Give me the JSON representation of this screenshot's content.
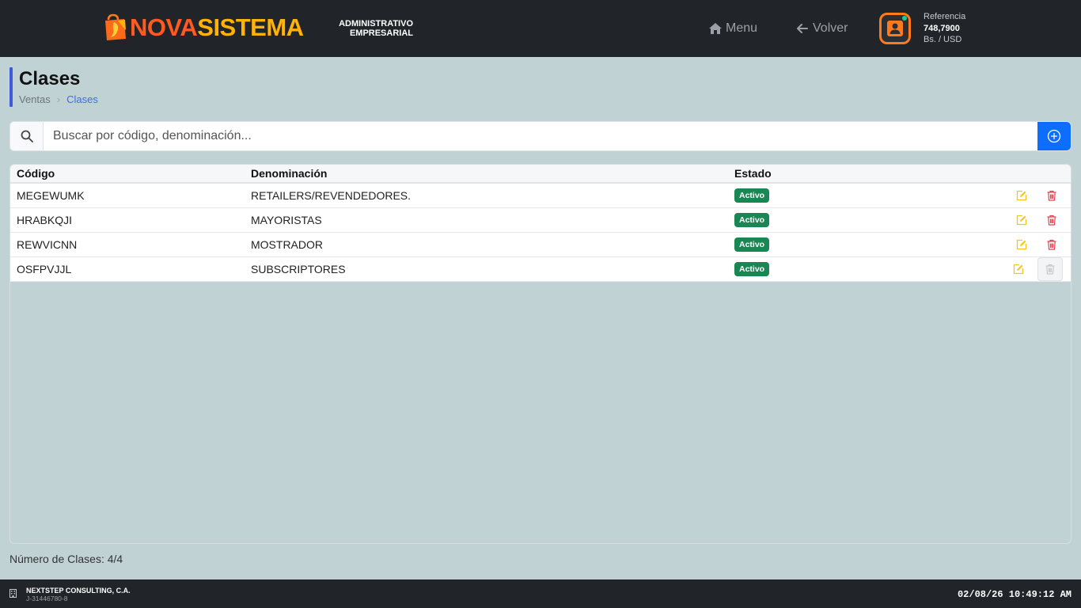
{
  "header": {
    "logo_part1": "NOVA",
    "logo_part2": "SISTEMA",
    "subtitle_line1": "ADMINISTRATIVO",
    "subtitle_line2": "EMPRESARIAL",
    "menu_label": "Menu",
    "back_label": "Volver",
    "ref_label": "Referencia",
    "ref_value": "748,7900",
    "ref_unit": "Bs. / USD",
    "colors": {
      "bar": "#212529",
      "brand_orange": "#ff5a1f",
      "brand_yellow": "#ffb20a",
      "status_online": "#20c997"
    }
  },
  "page": {
    "title": "Clases",
    "breadcrumb": [
      "Ventas",
      "Clases"
    ],
    "breadcrumb_separator": "›"
  },
  "search": {
    "placeholder": "Buscar por código, denominación...",
    "value": "",
    "icon": "search-icon",
    "add_icon": "plus-circle-icon"
  },
  "table": {
    "headers": {
      "code": "Código",
      "name": "Denominación",
      "status": "Estado"
    },
    "rows": [
      {
        "code": "MEGEWUMK",
        "name": "RETAILERS/REVENDEDORES.",
        "status": "Activo",
        "delete_enabled": true
      },
      {
        "code": "HRABKQJI",
        "name": "MAYORISTAS",
        "status": "Activo",
        "delete_enabled": true
      },
      {
        "code": "REWVICNN",
        "name": "MOSTRADOR",
        "status": "Activo",
        "delete_enabled": true
      },
      {
        "code": "OSFPVJJL",
        "name": "SUBSCRIPTORES",
        "status": "Activo",
        "delete_enabled": false
      }
    ]
  },
  "count_text": "Número de Clases: 4/4",
  "footer": {
    "company": "NEXTSTEP CONSULTING, C.A.",
    "rif": "J-31446780-8",
    "datetime": "02/08/26 10:49:12 AM"
  }
}
